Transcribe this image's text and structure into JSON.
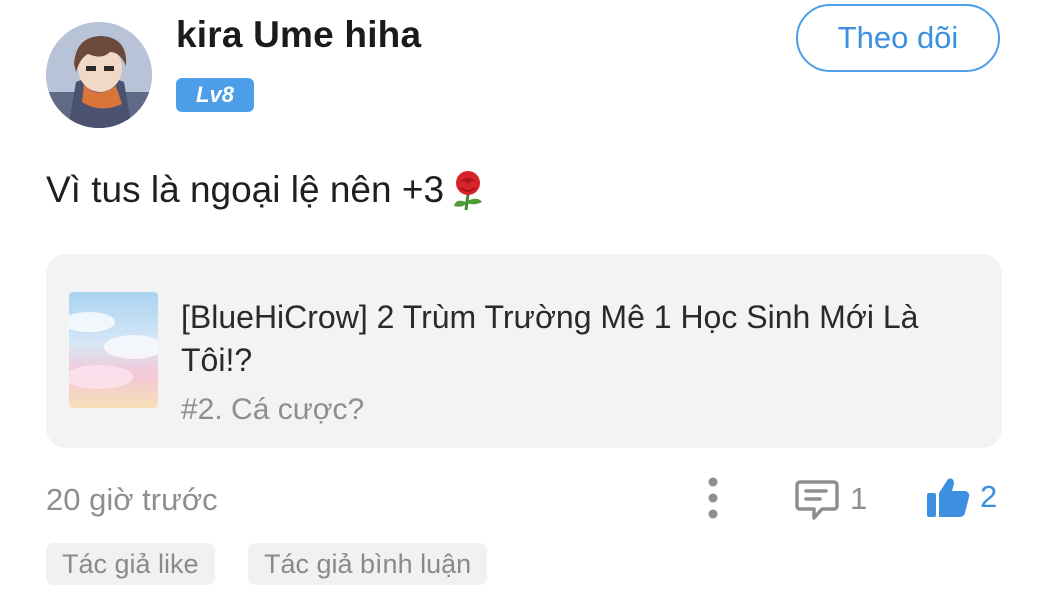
{
  "user": {
    "name": "kira Ume hiha",
    "level": "Lv8"
  },
  "follow_button": {
    "label": "Theo dõi"
  },
  "comment": {
    "text": "Vì tus là ngoại lệ nên +3",
    "emoji": "rose-icon"
  },
  "story": {
    "title": "[BlueHiCrow] 2 Trùm Trường Mê 1 Học Sinh Mới Là Tôi!?",
    "chapter": "#2. Cá cược?"
  },
  "meta": {
    "timestamp": "20 giờ trước",
    "reply_count": "1",
    "like_count": "2"
  },
  "tags": [
    {
      "label": "Tác giả like"
    },
    {
      "label": "Tác giả bình luận"
    }
  ],
  "colors": {
    "accent": "#4c9ee8",
    "card_background": "#f3f3f3",
    "muted_text": "#8e8e8e"
  },
  "icons": {
    "more": "more-vertical-icon",
    "reply": "comment-icon",
    "like": "thumbs-up-icon"
  }
}
